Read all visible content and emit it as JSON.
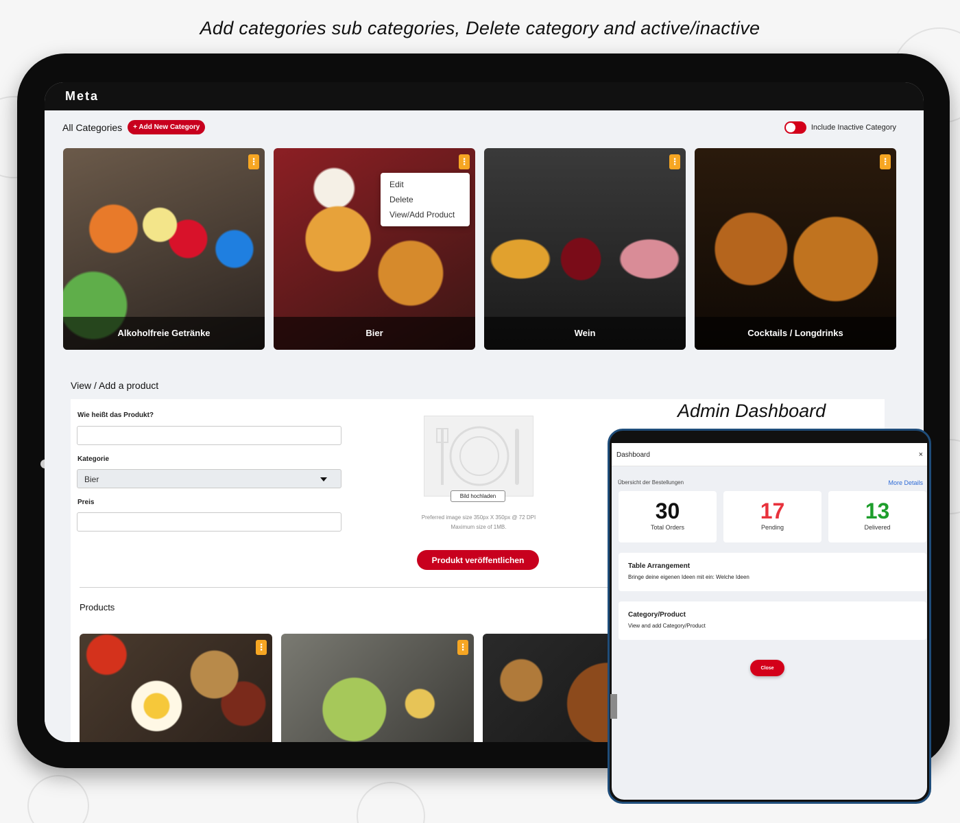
{
  "headline": "Add categories sub categories, Delete category and active/inactive",
  "app": {
    "title": "Meta"
  },
  "categories": {
    "title": "All Categories",
    "add_button": "+ Add New Category",
    "toggle_label": "Include Inactive Category",
    "toggle_on": true,
    "items": [
      {
        "name": "Alkoholfreie Getränke"
      },
      {
        "name": "Bier"
      },
      {
        "name": "Wein"
      },
      {
        "name": "Cocktails / Longdrinks"
      }
    ],
    "context_menu": [
      "Edit",
      "Delete",
      "View/Add Product"
    ]
  },
  "product_form": {
    "section_title": "View / Add a product",
    "name_label": "Wie heißt das Produkt?",
    "category_label": "Kategorie",
    "category_value": "Bier",
    "price_label": "Preis",
    "upload_button": "Bild hochladen",
    "image_note_1": "Preferred image size 350px X 350px @ 72 DPI",
    "image_note_2": "Maximum size of 1MB.",
    "publish_button": "Produkt veröffentlichen"
  },
  "products": {
    "title": "Products"
  },
  "admin": {
    "heading": "Admin Dashboard",
    "dashboard_title": "Dashboard",
    "close_x": "×",
    "overview_label": "Übersicht der Bestellungen",
    "more_details": "More Details",
    "stats": [
      {
        "value": "30",
        "label": "Total Orders",
        "color": "#111111"
      },
      {
        "value": "17",
        "label": "Pending",
        "color": "#e8323c"
      },
      {
        "value": "13",
        "label": "Delivered",
        "color": "#1e9e2c"
      }
    ],
    "table_title": "Table Arrangement",
    "table_sub": "Bringe deine eigenen Ideen mit ein: Welche Ideen",
    "cat_title": "Category/Product",
    "cat_sub": "View and add Category/Product",
    "close_button": "Close"
  },
  "colors": {
    "accent_red": "#c8001e",
    "kebab_orange": "#f6a623",
    "link_blue": "#2e6bd6",
    "phone_border": "#1f4d7a"
  },
  "icons": {
    "kebab": "more-vertical-icon",
    "close": "close-icon",
    "caret": "chevron-down-icon",
    "plate": "plate-cutlery-icon"
  }
}
